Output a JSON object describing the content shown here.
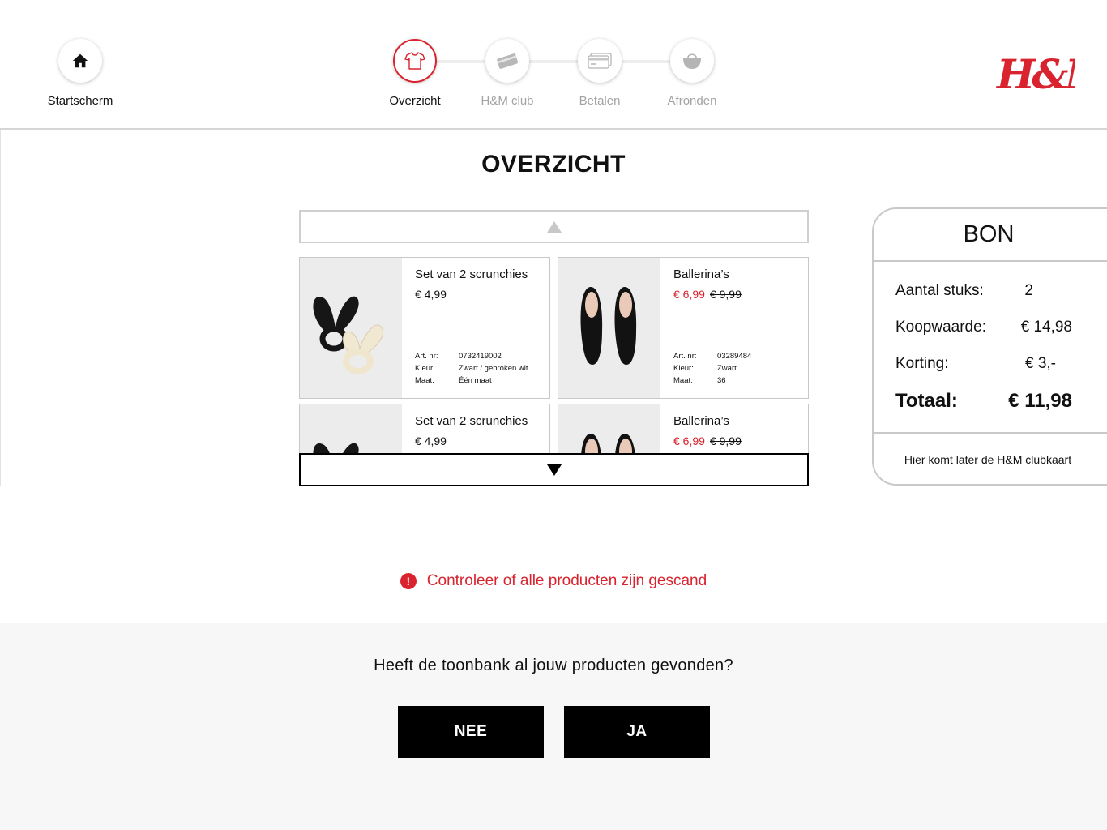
{
  "nav": {
    "home_label": "Startscherm",
    "steps": [
      {
        "label": "Overzicht",
        "icon": "tshirt-icon",
        "state": "active"
      },
      {
        "label": "H&M club",
        "icon": "club-card-icon",
        "state": "inactive"
      },
      {
        "label": "Betalen",
        "icon": "payment-card-icon",
        "state": "inactive"
      },
      {
        "label": "Afronden",
        "icon": "bag-icon",
        "state": "inactive"
      }
    ],
    "brand": "H&M",
    "accent_color": "#d9232e"
  },
  "page": {
    "title": "OVERZICHT"
  },
  "products": [
    {
      "name": "Set van 2 scrunchies",
      "price": "€ 4,99",
      "old_price": "",
      "on_sale": false,
      "details": [
        {
          "label": "Art. nr:",
          "value": "0732419002"
        },
        {
          "label": "Kleur:",
          "value": "Zwart / gebroken wit"
        },
        {
          "label": "Maat:",
          "value": "Één maat"
        }
      ]
    },
    {
      "name": "Ballerina’s",
      "price": "€ 6,99",
      "old_price": "€ 9,99",
      "on_sale": true,
      "details": [
        {
          "label": "Art. nr:",
          "value": "03289484"
        },
        {
          "label": "Kleur:",
          "value": "Zwart"
        },
        {
          "label": "Maat:",
          "value": "36"
        }
      ]
    },
    {
      "name": "Set van 2 scrunchies",
      "price": "€ 4,99",
      "old_price": "",
      "on_sale": false
    },
    {
      "name": "Ballerina’s",
      "price": "€ 6,99",
      "old_price": "€ 9,99",
      "on_sale": true
    }
  ],
  "receipt": {
    "title": "BON",
    "rows": [
      {
        "label": "Aantal stuks:",
        "value": "2"
      },
      {
        "label": "Koopwaarde:",
        "value": "€ 14,98"
      },
      {
        "label": "Korting:",
        "value": "€ 3,-"
      }
    ],
    "total_label": "Totaal:",
    "total_value": "€ 11,98",
    "footer": "Hier komt later de H&M clubkaart"
  },
  "warning": {
    "text": "Controleer of alle producten zijn gescand",
    "icon": "exclamation-icon"
  },
  "question": {
    "text": "Heeft de toonbank al jouw producten gevonden?",
    "no_label": "NEE",
    "yes_label": "JA"
  }
}
